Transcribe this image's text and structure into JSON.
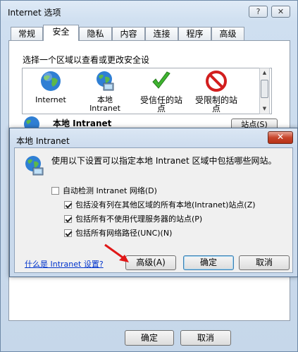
{
  "outer_window": {
    "title": "Internet 选项",
    "help_button": "?",
    "close_button": "✕",
    "tabs": [
      "常规",
      "安全",
      "隐私",
      "内容",
      "连接",
      "程序",
      "高级"
    ],
    "active_tab": "安全",
    "zone_prompt": "选择一个区域以查看或更改安全设",
    "zones": [
      {
        "label": "Internet",
        "icon": "globe-icon"
      },
      {
        "label": "本地\nIntranet",
        "icon": "intranet-globe-icon"
      },
      {
        "label": "受信任的站\n点",
        "icon": "check-icon"
      },
      {
        "label": "受限制的站\n点",
        "icon": "forbidden-icon"
      }
    ],
    "zone_detail_title": "本地 Intranet",
    "sites_button": "站点(S)",
    "ok_button": "确定",
    "cancel_button": "取消"
  },
  "intranet_dialog": {
    "title": "本地 Intranet",
    "close_button": "✕",
    "description": "使用以下设置可以指定本地 Intranet 区域中包括哪些网站。",
    "options": [
      {
        "label": "自动检测 Intranet 网络(D)",
        "checked": false
      },
      {
        "label": "包括没有列在其他区域的所有本地(Intranet)站点(Z)",
        "checked": true
      },
      {
        "label": "包括所有不使用代理服务器的站点(P)",
        "checked": true
      },
      {
        "label": "包括所有网络路径(UNC)(N)",
        "checked": true
      }
    ],
    "help_link": "什么是 Intranet 设置?",
    "advanced_button": "高级(A)",
    "ok_button": "确定",
    "cancel_button": "取消"
  },
  "colors": {
    "arrow": "#e01818",
    "link": "#0033cc",
    "close_red": "#c7452c"
  }
}
